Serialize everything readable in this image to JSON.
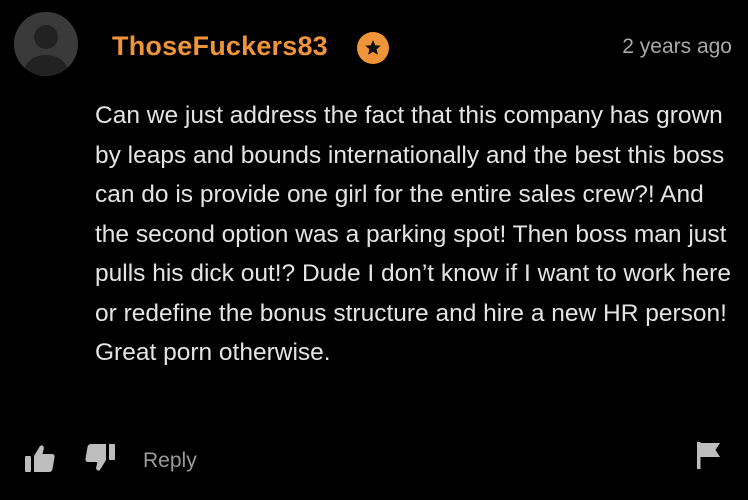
{
  "comment": {
    "username": "ThoseFuckers83",
    "timestamp": "2 years ago",
    "text": "Can we just address the fact that this company has grown by leaps and bounds internationally and the best this boss can do is provide one girl for the entire sales crew?! And the second option was a parking spot! Then boss man just pulls his dick out!? Dude I don’t know if I want to work here or redefine the bonus structure and hire a new HR person! Great porn otherwise.",
    "actions": {
      "reply_label": "Reply"
    },
    "icons": {
      "avatar": "default-user-avatar",
      "badge": "star-icon",
      "like": "thumbs-up-icon",
      "dislike": "thumbs-down-icon",
      "report": "flag-icon"
    }
  },
  "colors": {
    "background": "#000000",
    "username": "#f0943a",
    "badge": "#f0943a",
    "text": "#e4e4e4",
    "muted": "#9a9a9a"
  }
}
